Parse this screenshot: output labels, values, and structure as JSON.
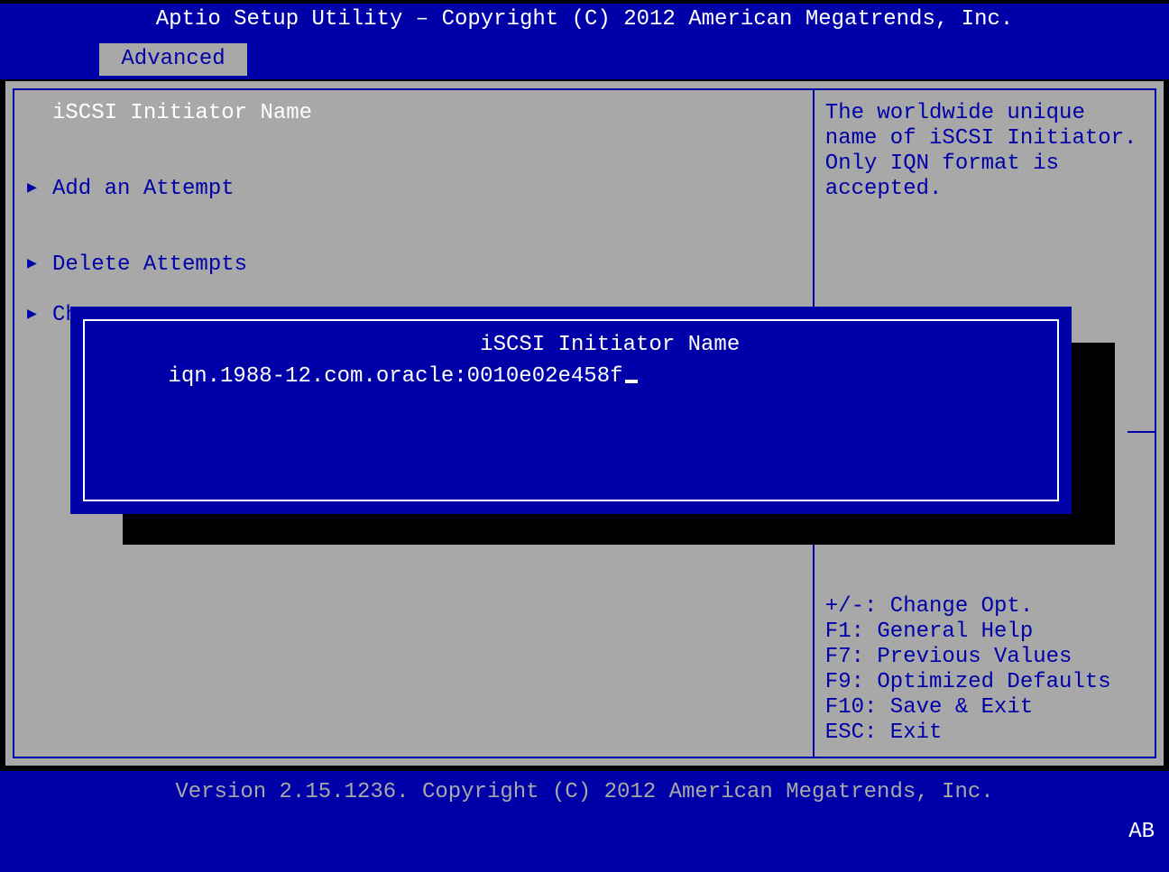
{
  "header": {
    "title": "Aptio Setup Utility – Copyright (C) 2012 American Megatrends, Inc.",
    "tabs": [
      {
        "label": " Advanced "
      }
    ]
  },
  "left": {
    "field_label": "iSCSI Initiator Name",
    "items": [
      {
        "label": "Add an Attempt"
      },
      {
        "label": "Delete Attempts"
      },
      {
        "label": "Ch"
      }
    ]
  },
  "right": {
    "help": "The worldwide unique name of iSCSI Initiator. Only IQN format is accepted.",
    "hints": [
      "+/-: Change Opt.",
      "F1: General Help",
      "F7: Previous Values",
      "F9: Optimized Defaults",
      "F10: Save & Exit",
      "ESC: Exit"
    ]
  },
  "popup": {
    "title": " iSCSI Initiator Name ",
    "value": "iqn.1988-12.com.oracle:0010e02e458f"
  },
  "footer": {
    "version": "Version 2.15.1236. Copyright (C) 2012 American Megatrends, Inc.",
    "corner": "AB"
  }
}
